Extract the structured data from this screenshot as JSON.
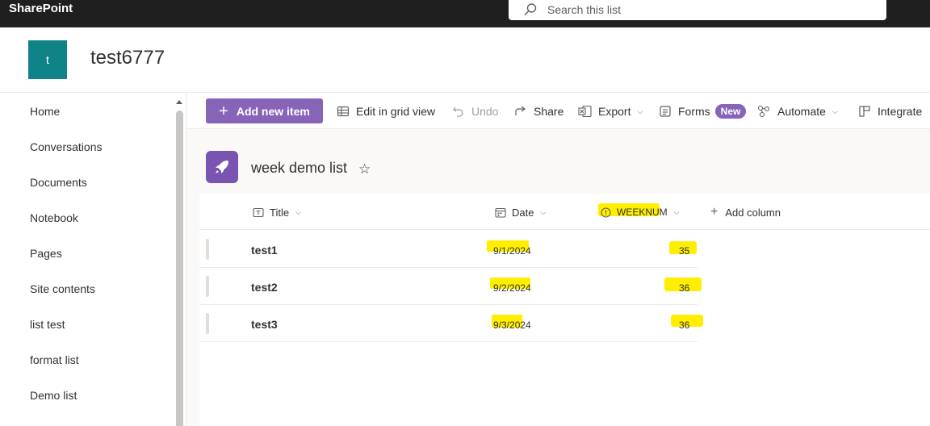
{
  "suite": {
    "brand": "SharePoint",
    "search_placeholder": "Search this list"
  },
  "site": {
    "logo_letter": "t",
    "title": "test6777"
  },
  "nav": {
    "items": [
      "Home",
      "Conversations",
      "Documents",
      "Notebook",
      "Pages",
      "Site contents",
      "list test",
      "format list",
      "Demo list"
    ]
  },
  "commands": {
    "add_new_item": "Add new item",
    "edit_grid": "Edit in grid view",
    "undo": "Undo",
    "share": "Share",
    "export": "Export",
    "forms": "Forms",
    "forms_badge": "New",
    "automate": "Automate",
    "integrate": "Integrate"
  },
  "list": {
    "title": "week demo list",
    "columns": {
      "title": "Title",
      "date": "Date",
      "weeknum": "WEEKNUM",
      "add_column": "Add column"
    },
    "rows": [
      {
        "title": "test1",
        "date": "9/1/2024",
        "weeknum": "35"
      },
      {
        "title": "test2",
        "date": "9/2/2024",
        "weeknum": "36"
      },
      {
        "title": "test3",
        "date": "9/3/2024",
        "weeknum": "36"
      }
    ]
  },
  "colors": {
    "accent": "#8764b8",
    "site_logo": "#0f8387",
    "highlight": "#ffee00",
    "suitebar": "#1f1f1f"
  },
  "icons": [
    "search-icon",
    "plus-icon",
    "grid-icon",
    "undo-icon",
    "share-icon",
    "excel-icon",
    "forms-icon",
    "automate-icon",
    "integrate-icon",
    "rocket-icon",
    "star-icon",
    "text-column-icon",
    "calendar-icon",
    "info-icon",
    "chevron-down-icon"
  ]
}
